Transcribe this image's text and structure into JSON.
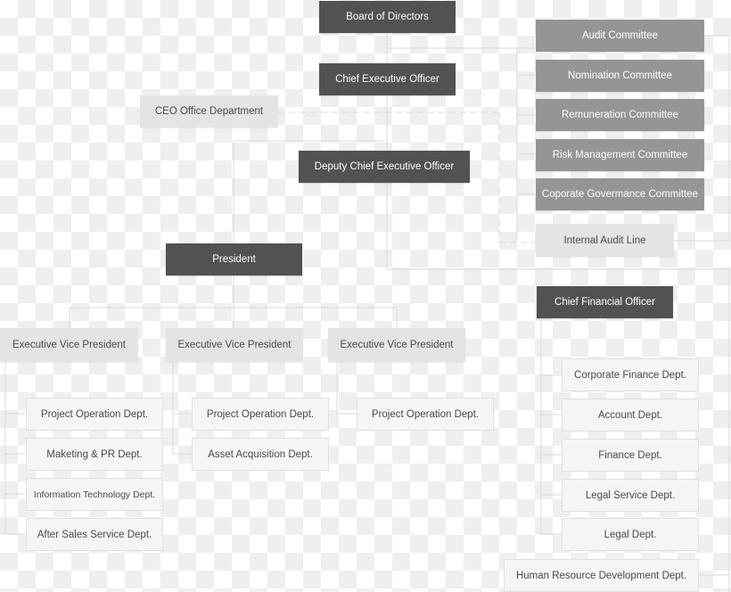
{
  "chart": {
    "top": {
      "board": "Board of Directors",
      "ceo": "Chief Executive Officer",
      "ceo_office": "CEO Office Department",
      "deputy_ceo": "Deputy Chief Executive Officer",
      "president": "President",
      "cfo": "Chief Financial Officer"
    },
    "committees": [
      "Audit Committee",
      "Nomination Committee",
      "Remuneration Committee",
      "Risk Management Committee",
      "Coporate Govermance Committee"
    ],
    "internal_audit": "Internal Audit Line",
    "evps": [
      {
        "title": "Executive Vice President",
        "departments": [
          "Project Operation Dept.",
          "Maketing & PR Dept.",
          "Information Technology Dept.",
          "After Sales Service Dept."
        ]
      },
      {
        "title": "Executive Vice President",
        "departments": [
          "Project Operation Dept.",
          "Asset Acquisition Dept."
        ]
      },
      {
        "title": "Executive Vice President",
        "departments": [
          "Project Operation Dept."
        ]
      }
    ],
    "cfo_departments": [
      "Corporate Finance Dept.",
      "Account Dept.",
      "Finance Dept.",
      "Legal Service Dept.",
      "Legal Dept."
    ],
    "hr_department": "Human Resource Development Dept."
  },
  "colors": {
    "executive": "#525252",
    "committee": "#959595",
    "office": "#e4e4e4",
    "department": "#f5f5f5"
  }
}
